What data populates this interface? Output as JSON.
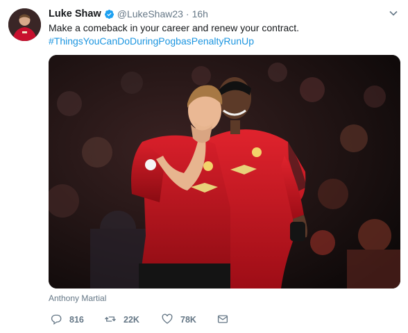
{
  "tweet": {
    "display_name": "Luke Shaw",
    "handle": "@LukeShaw23",
    "separator": "·",
    "time": "16h",
    "text": "Make a comeback in your career and renew your contract.",
    "hashtag": "#ThingsYouCanDoDuringPogbasPenaltyRunUp",
    "media_tag": "Anthony Martial",
    "stats": {
      "replies": "816",
      "retweets": "22K",
      "likes": "78K"
    }
  },
  "colors": {
    "link": "#1b95e0",
    "muted": "#657786",
    "verified": "#1da1f2",
    "jersey_red": "#c8102e"
  },
  "icons": {
    "verified": "verified-badge-icon",
    "caret": "chevron-down-icon",
    "reply": "reply-icon",
    "retweet": "retweet-icon",
    "like": "heart-icon",
    "dm": "envelope-icon"
  }
}
